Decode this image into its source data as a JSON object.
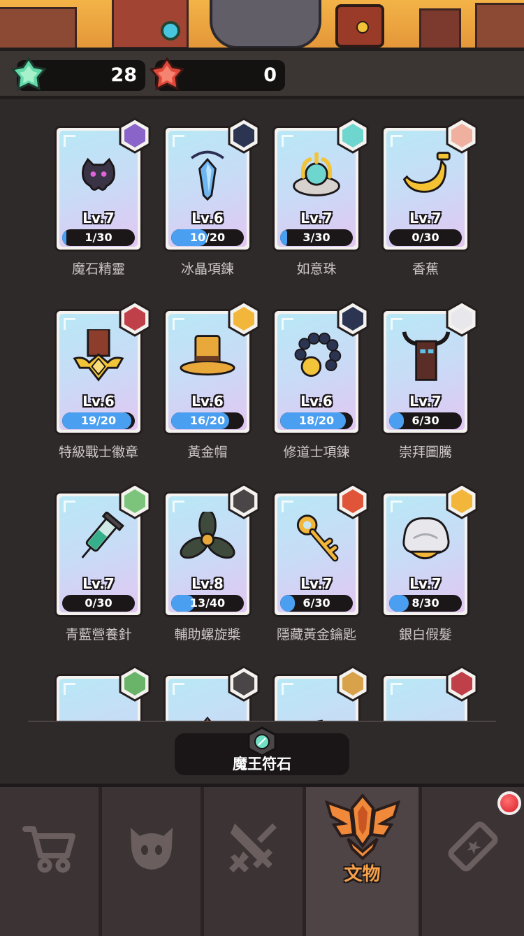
{
  "currency": {
    "green_gems": "28",
    "red_gems": "0",
    "green_icon": "green-gem-icon",
    "red_icon": "red-gem-icon"
  },
  "items": [
    {
      "name": "魔石精靈",
      "level": "Lv.7",
      "progress": "1/30",
      "fill": 0.033,
      "art": "shadow-spirit-icon"
    },
    {
      "name": "冰晶項鍊",
      "level": "Lv.6",
      "progress": "10/20",
      "fill": 0.5,
      "art": "ice-crystal-necklace-icon"
    },
    {
      "name": "如意珠",
      "level": "Lv.7",
      "progress": "3/30",
      "fill": 0.1,
      "art": "claw-pearl-icon"
    },
    {
      "name": "香蕉",
      "level": "Lv.7",
      "progress": "0/30",
      "fill": 0,
      "art": "banana-icon"
    },
    {
      "name": "特級戰士徽章",
      "level": "Lv.6",
      "progress": "19/20",
      "fill": 0.95,
      "art": "warrior-medal-icon"
    },
    {
      "name": "黃金帽",
      "level": "Lv.6",
      "progress": "16/20",
      "fill": 0.8,
      "art": "golden-hat-icon"
    },
    {
      "name": "修道士項鍊",
      "level": "Lv.6",
      "progress": "18/20",
      "fill": 0.9,
      "art": "monk-beads-icon"
    },
    {
      "name": "崇拜圖騰",
      "level": "Lv.7",
      "progress": "6/30",
      "fill": 0.2,
      "art": "totem-icon"
    },
    {
      "name": "青藍營養針",
      "level": "Lv.7",
      "progress": "0/30",
      "fill": 0,
      "art": "syringe-icon"
    },
    {
      "name": "輔助螺旋槳",
      "level": "Lv.8",
      "progress": "13/40",
      "fill": 0.325,
      "art": "propeller-icon"
    },
    {
      "name": "隱藏黃金鑰匙",
      "level": "Lv.7",
      "progress": "6/30",
      "fill": 0.2,
      "art": "golden-key-icon"
    },
    {
      "name": "銀白假髮",
      "level": "Lv.7",
      "progress": "8/30",
      "fill": 0.267,
      "art": "silver-wig-icon"
    },
    {
      "name": "",
      "level": "",
      "progress": "",
      "fill": 0,
      "art": "berries-icon"
    },
    {
      "name": "",
      "level": "",
      "progress": "",
      "fill": 0,
      "art": "spiked-helmet-icon"
    },
    {
      "name": "",
      "level": "",
      "progress": "",
      "fill": 0,
      "art": "ore-chunk-icon"
    },
    {
      "name": "",
      "level": "",
      "progress": "",
      "fill": 0,
      "art": "cannon-icon"
    }
  ],
  "rune_button": {
    "label": "魔王符石",
    "icon": "rune-stone-icon"
  },
  "nav": {
    "tabs": [
      {
        "id": "shop",
        "icon": "cart-icon",
        "label": ""
      },
      {
        "id": "monster",
        "icon": "demon-face-icon",
        "label": ""
      },
      {
        "id": "battle",
        "icon": "crossed-swords-icon",
        "label": ""
      },
      {
        "id": "artifacts",
        "icon": "wing-emblem-icon",
        "label": "文物"
      },
      {
        "id": "ticket",
        "icon": "ticket-icon",
        "label": ""
      }
    ],
    "active": "artifacts",
    "notification_on": "ticket"
  },
  "colors": {
    "progress_fill": "#4a9ff0",
    "active_label": "#f7a14a",
    "background": "#2e2a2a"
  }
}
